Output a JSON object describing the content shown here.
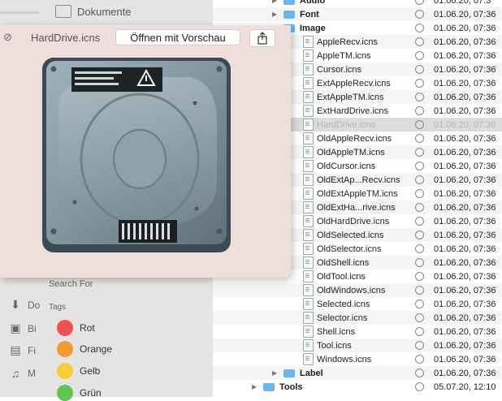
{
  "sidebar": {
    "top_item": "Dokumente",
    "truncated_items": [
      {
        "icon": "download-icon",
        "label": "Do"
      },
      {
        "icon": "camera-icon",
        "label": "Bi"
      },
      {
        "icon": "film-icon",
        "label": "Fi"
      },
      {
        "icon": "music-icon",
        "label": "M"
      }
    ],
    "search_for_label": "Search For",
    "tags_label": "Tags",
    "tags": [
      {
        "label": "Rot",
        "color": "#f2524f"
      },
      {
        "label": "Orange",
        "color": "#f39b32"
      },
      {
        "label": "Gelb",
        "color": "#f5cf35"
      },
      {
        "label": "Grün",
        "color": "#62c452"
      }
    ]
  },
  "filelist": {
    "rows": [
      {
        "kind": "folder",
        "name": "Audio",
        "date": "01.06.20, 07:3",
        "depth": 1,
        "expanded": false
      },
      {
        "kind": "folder",
        "name": "Font",
        "date": "01.06.20, 07:36",
        "depth": 1,
        "expanded": false
      },
      {
        "kind": "folder",
        "name": "Image",
        "date": "01.06.20, 07:36",
        "depth": 1,
        "expanded": true
      },
      {
        "kind": "file",
        "name": "AppleRecv.icns",
        "date": "01.06.20, 07:36",
        "depth": 2
      },
      {
        "kind": "file",
        "name": "AppleTM.icns",
        "date": "01.06.20, 07:36",
        "depth": 2
      },
      {
        "kind": "file",
        "name": "Cursor.icns",
        "date": "01.06.20, 07:36",
        "depth": 2
      },
      {
        "kind": "file",
        "name": "ExtAppleRecv.icns",
        "date": "01.06.20, 07:36",
        "depth": 2
      },
      {
        "kind": "file",
        "name": "ExtAppleTM.icns",
        "date": "01.06.20, 07:36",
        "depth": 2
      },
      {
        "kind": "file",
        "name": "ExtHardDrive.icns",
        "date": "01.06.20, 07:36",
        "depth": 2
      },
      {
        "kind": "file",
        "name": "HardDrive.icns",
        "date": "01.06.20, 07:36",
        "depth": 2,
        "selected": true
      },
      {
        "kind": "file",
        "name": "OldAppleRecv.icns",
        "date": "01.06.20, 07:36",
        "depth": 2
      },
      {
        "kind": "file",
        "name": "OldAppleTM.icns",
        "date": "01.06.20, 07:36",
        "depth": 2
      },
      {
        "kind": "file",
        "name": "OldCursor.icns",
        "date": "01.06.20, 07:36",
        "depth": 2
      },
      {
        "kind": "file",
        "name": "OldExtAp...Recv.icns",
        "date": "01.06.20, 07:36",
        "depth": 2
      },
      {
        "kind": "file",
        "name": "OldExtAppleTM.icns",
        "date": "01.06.20, 07:36",
        "depth": 2
      },
      {
        "kind": "file",
        "name": "OldExtHa...rive.icns",
        "date": "01.06.20, 07:36",
        "depth": 2
      },
      {
        "kind": "file",
        "name": "OldHardDrive.icns",
        "date": "01.06.20, 07:36",
        "depth": 2
      },
      {
        "kind": "file",
        "name": "OldSelected.icns",
        "date": "01.06.20, 07:36",
        "depth": 2
      },
      {
        "kind": "file",
        "name": "OldSelector.icns",
        "date": "01.06.20, 07:36",
        "depth": 2
      },
      {
        "kind": "file",
        "name": "OldShell.icns",
        "date": "01.06.20, 07:36",
        "depth": 2
      },
      {
        "kind": "file",
        "name": "OldTool.icns",
        "date": "01.06.20, 07:36",
        "depth": 2
      },
      {
        "kind": "file",
        "name": "OldWindows.icns",
        "date": "01.06.20, 07:36",
        "depth": 2
      },
      {
        "kind": "file",
        "name": "Selected.icns",
        "date": "01.06.20, 07:36",
        "depth": 2
      },
      {
        "kind": "file",
        "name": "Selector.icns",
        "date": "01.06.20, 07:36",
        "depth": 2
      },
      {
        "kind": "file",
        "name": "Shell.icns",
        "date": "01.06.20, 07:36",
        "depth": 2
      },
      {
        "kind": "file",
        "name": "Tool.icns",
        "date": "01.06.20, 07:36",
        "depth": 2
      },
      {
        "kind": "file",
        "name": "Windows.icns",
        "date": "01.06.20, 07:36",
        "depth": 2
      },
      {
        "kind": "folder",
        "name": "Label",
        "date": "01.06.20, 07:36",
        "depth": 1,
        "expanded": false
      },
      {
        "kind": "folder",
        "name": "Tools",
        "date": "05.07.20, 12:10",
        "depth": 0,
        "expanded": false
      }
    ]
  },
  "quicklook": {
    "title": "HardDrive.icns",
    "open_button": "Öffnen mit Vorschau",
    "share_icon": "share-icon",
    "close_icon": "close-icon",
    "preview_icon": "hard-drive-icon",
    "background": "#f0dedd"
  }
}
